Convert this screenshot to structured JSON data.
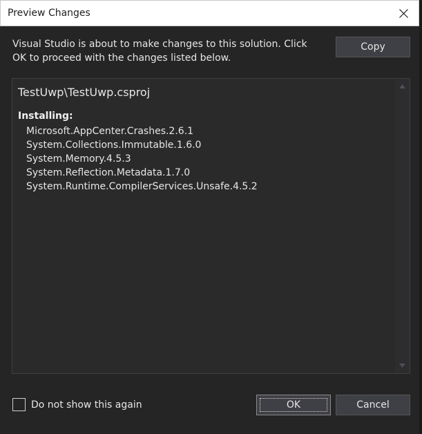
{
  "window": {
    "title": "Preview Changes"
  },
  "message": "Visual Studio is about to make changes to this solution. Click OK to proceed with the changes listed below.",
  "toolbar": {
    "copy_label": "Copy"
  },
  "changes": {
    "project_path": "TestUwp\\TestUwp.csproj",
    "installing_label": "Installing:",
    "packages": [
      "Microsoft.AppCenter.Crashes.2.6.1",
      "System.Collections.Immutable.1.6.0",
      "System.Memory.4.5.3",
      "System.Reflection.Metadata.1.7.0",
      "System.Runtime.CompilerServices.Unsafe.4.5.2"
    ]
  },
  "footer": {
    "dont_show_label": "Do not show this again",
    "dont_show_checked": false,
    "ok_label": "OK",
    "cancel_label": "Cancel"
  },
  "colors": {
    "dialog_bg": "#252526",
    "titlebar_bg": "#ffffff",
    "button_bg": "#3f3f46",
    "text": "#e6e6e6"
  },
  "icons": {
    "close": "close-icon",
    "scroll_up": "scroll-up-icon",
    "scroll_down": "scroll-down-icon"
  }
}
